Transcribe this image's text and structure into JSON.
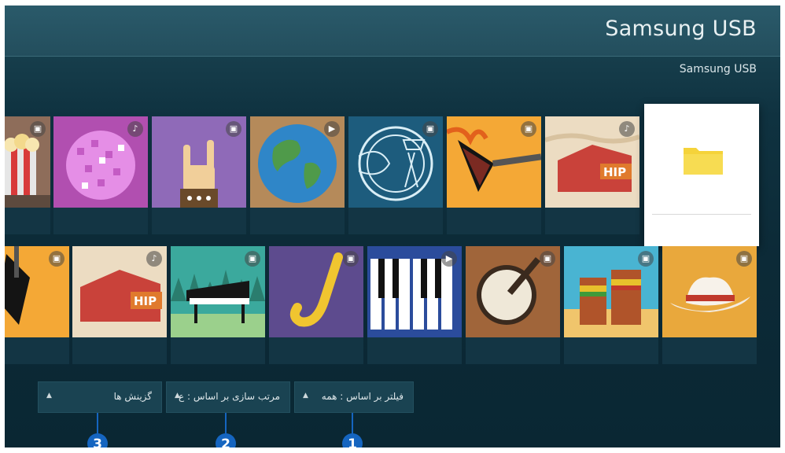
{
  "header": {
    "title": "Samsung USB"
  },
  "breadcrumb": "Samsung USB",
  "row1": [
    {
      "thumb": "popcorn",
      "badge": "photo-icon"
    },
    {
      "thumb": "disco-ball",
      "badge": "music-icon"
    },
    {
      "thumb": "rock-hand",
      "badge": "photo-icon"
    },
    {
      "thumb": "globe",
      "badge": "video-icon"
    },
    {
      "thumb": "music-poster",
      "badge": "photo-icon"
    },
    {
      "thumb": "electric-guitar",
      "badge": "photo-icon"
    },
    {
      "thumb": "tent-hip",
      "badge": "music-icon"
    }
  ],
  "row2": [
    {
      "thumb": "electric-guitar",
      "badge": "photo-icon"
    },
    {
      "thumb": "tent-hip",
      "badge": "music-icon"
    },
    {
      "thumb": "grand-piano",
      "badge": "photo-icon"
    },
    {
      "thumb": "saxophone",
      "badge": "photo-icon"
    },
    {
      "thumb": "piano-keys",
      "badge": "video-icon"
    },
    {
      "thumb": "banjo",
      "badge": "photo-icon"
    },
    {
      "thumb": "bongo-drums",
      "badge": "photo-icon"
    },
    {
      "thumb": "cowboy-hat",
      "badge": "photo-icon"
    }
  ],
  "folder": {
    "icon": "folder-icon",
    "color": "#f5d33a"
  },
  "controls": {
    "filter_label": "فیلتر بر اساس : همه",
    "sort_label": "مرتب سازی بر اساس : ع",
    "options_label": "گزینش ها"
  },
  "callouts": [
    "1",
    "2",
    "3"
  ],
  "accent": "#1565c0"
}
